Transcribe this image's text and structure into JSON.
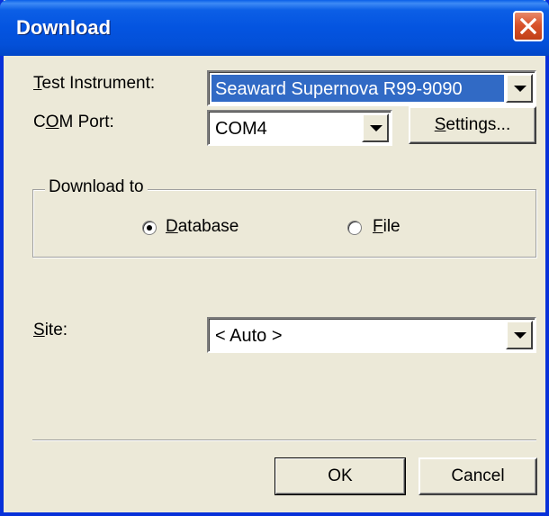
{
  "window": {
    "title": "Download"
  },
  "fields": {
    "instrument": {
      "label": "Test Instrument:",
      "value": "Seaward Supernova R99-9090"
    },
    "com_port": {
      "label": "COM Port:",
      "value": "COM4"
    },
    "settings_button": "Settings...",
    "site": {
      "label": "Site:",
      "value": "< Auto >"
    }
  },
  "download_to": {
    "legend": "Download to",
    "options": [
      {
        "label": "Database",
        "selected": true
      },
      {
        "label": "File",
        "selected": false
      }
    ]
  },
  "buttons": {
    "ok": "OK",
    "cancel": "Cancel"
  },
  "icons": {
    "close": "close-icon",
    "dropdown": "chevron-down-icon"
  }
}
